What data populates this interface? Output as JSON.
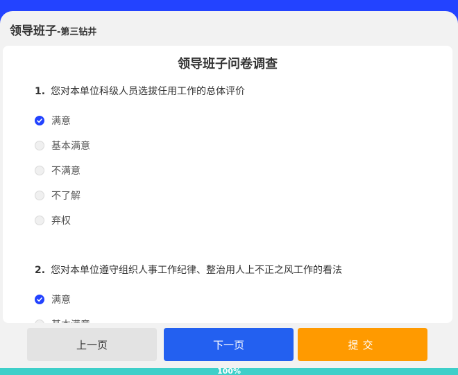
{
  "header": {
    "org": "领导班子",
    "sub": "-第三钻井"
  },
  "survey": {
    "title": "领导班子问卷调查"
  },
  "questions": [
    {
      "number": "1.",
      "text": "您对本单位科级人员选拔任用工作的总体评价",
      "options": [
        {
          "label": "满意",
          "checked": true
        },
        {
          "label": "基本满意",
          "checked": false
        },
        {
          "label": "不满意",
          "checked": false
        },
        {
          "label": "不了解",
          "checked": false
        },
        {
          "label": "弃权",
          "checked": false
        }
      ]
    },
    {
      "number": "2.",
      "text": "您对本单位遵守组织人事工作纪律、整治用人上不正之风工作的看法",
      "options": [
        {
          "label": "满意",
          "checked": true
        },
        {
          "label": "基本满意",
          "checked": false
        }
      ]
    }
  ],
  "footer": {
    "prev_label": "上一页",
    "next_label": "下一页",
    "submit_label": "提交"
  },
  "progress": {
    "value": 1.0,
    "text": "100%"
  },
  "colors": {
    "accent": "#2343ff",
    "next": "#2360f0",
    "submit": "#ff9a00",
    "progress": "#3ecfc9"
  }
}
